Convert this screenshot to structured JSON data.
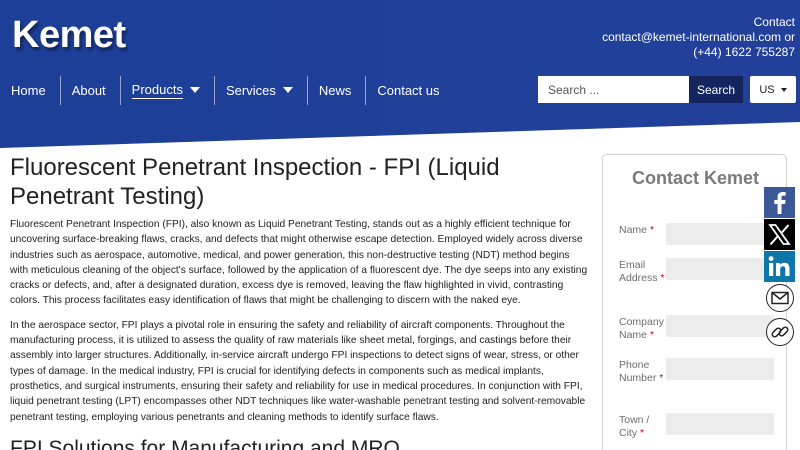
{
  "header": {
    "logo": "Kemet",
    "contact_title": "Contact",
    "contact_email": "contact@kemet-international.com or",
    "contact_phone": "(+44) 1622 755287"
  },
  "nav": {
    "items": [
      {
        "label": "Home"
      },
      {
        "label": "About"
      },
      {
        "label": "Products"
      },
      {
        "label": "Services"
      },
      {
        "label": "News"
      },
      {
        "label": "Contact us"
      }
    ]
  },
  "search": {
    "placeholder": "Search ...",
    "button": "Search"
  },
  "lang": {
    "selected": "US"
  },
  "main": {
    "title": "Fluorescent Penetrant Inspection - FPI (Liquid Penetrant Testing)",
    "para1": "Fluorescent Penetrant Inspection (FPI), also known as Liquid Penetrant Testing, stands out as a highly efficient technique for uncovering surface-breaking flaws, cracks, and defects that might otherwise escape detection. Employed widely across diverse industries such as aerospace, automotive, medical, and power generation, this non-destructive testing (NDT) method begins with meticulous cleaning of the object's surface, followed by the application of a fluorescent dye. The dye seeps into any existing cracks or defects, and, after a designated duration, excess dye is removed, leaving the flaw highlighted in vivid, contrasting colors. This process facilitates easy identification of flaws that might be challenging to discern with the naked eye.",
    "para2": "In the aerospace sector, FPI plays a pivotal role in ensuring the safety and reliability of aircraft components. Throughout the manufacturing process, it is utilized to assess the quality of raw materials like sheet metal, forgings, and castings before their assembly into larger structures. Additionally, in-service aircraft undergo FPI inspections to detect signs of wear, stress, or other types of damage. In the medical industry, FPI is crucial for identifying defects in components such as medical implants, prosthetics, and surgical instruments, ensuring their safety and reliability for use in medical procedures. In conjunction with FPI, liquid penetrant testing (LPT) encompasses other NDT techniques like water-washable penetrant testing and solvent-removable penetrant testing, employing various penetrants and cleaning methods to identify surface flaws.",
    "section_title": "FPI Solutions for Manufacturing and MRO"
  },
  "contact_form": {
    "title": "Contact Kemet",
    "fields": [
      {
        "label": "Name",
        "required": "*"
      },
      {
        "label": "Email Address",
        "required": "*"
      },
      {
        "label": "Company Name",
        "required": "*"
      },
      {
        "label": "Phone Number",
        "required": "*"
      },
      {
        "label": "Town / City",
        "required": "*"
      }
    ]
  },
  "social": {
    "icons": [
      "facebook-icon",
      "x-icon",
      "linkedin-icon",
      "email-icon",
      "link-icon"
    ]
  },
  "colors": {
    "header_blue": "#1f3a93",
    "search_button": "#14245e",
    "facebook": "#3b5998",
    "linkedin": "#0e76a8",
    "required": "#d0021b"
  }
}
